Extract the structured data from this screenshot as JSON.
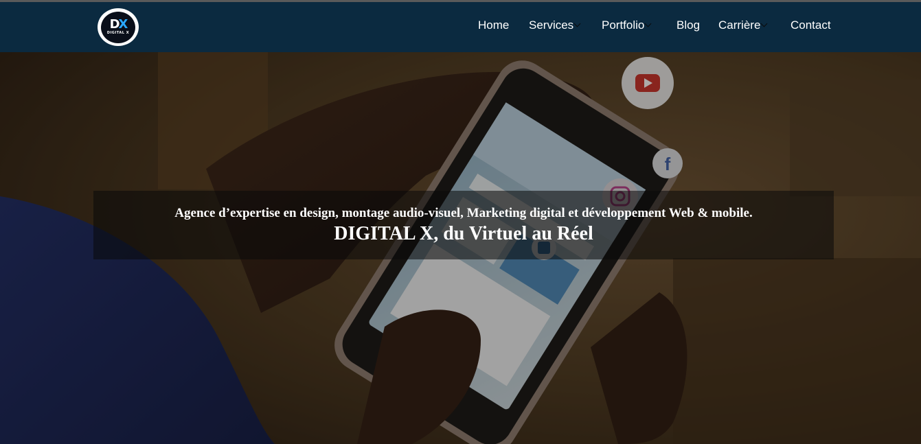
{
  "brand": {
    "logo_mark_left": "D",
    "logo_mark_right": "X",
    "logo_sub": "DIGITAL X"
  },
  "nav": {
    "items": [
      {
        "label": "Home",
        "has_dropdown": false
      },
      {
        "label": "Services",
        "has_dropdown": true
      },
      {
        "label": "Portfolio",
        "has_dropdown": true
      },
      {
        "label": "Blog",
        "has_dropdown": false
      },
      {
        "label": "Carrière",
        "has_dropdown": true
      },
      {
        "label": "Contact",
        "has_dropdown": false
      }
    ]
  },
  "hero": {
    "subtitle": "Agence d’expertise en design, montage audio-visuel, Marketing digital et développement Web & mobile.",
    "title": "DIGITAL X, du Virtuel au Réel",
    "background_description_icons": [
      "youtube-icon",
      "facebook-icon",
      "instagram-icon",
      "linkedin-icon"
    ]
  },
  "colors": {
    "navbar": "#0b2a40",
    "accent": "#2aa8ff",
    "text": "#ffffff"
  }
}
